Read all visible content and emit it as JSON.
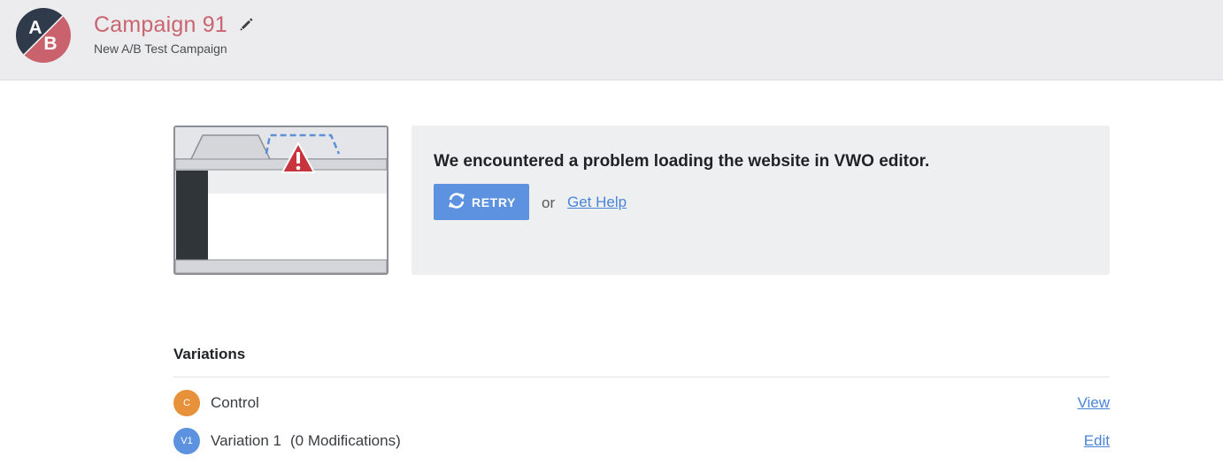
{
  "header": {
    "avatar": {
      "letters": [
        "A",
        "B"
      ],
      "colors": [
        "#2f3b4a",
        "#c9626c"
      ]
    },
    "title": "Campaign 91",
    "subtitle": "New A/B Test Campaign",
    "edit_icon": "pencil-icon"
  },
  "error": {
    "message": "We encountered a problem loading the website in VWO editor.",
    "retry_label": "RETRY",
    "retry_icon": "refresh-icon",
    "or_text": "or",
    "help_link": "Get Help",
    "illustration_icon": "warning-icon"
  },
  "variations": {
    "heading": "Variations",
    "items": [
      {
        "badge": "C",
        "badge_color": "#e8913b",
        "name": "Control",
        "modifications": "",
        "action": "View"
      },
      {
        "badge": "V1",
        "badge_color": "#5c92e0",
        "name": "Variation 1",
        "modifications": "(0 Modifications)",
        "action": "Edit"
      }
    ]
  },
  "colors": {
    "accent": "#5c92e0",
    "title": "#c96570",
    "link": "#4a84d6"
  }
}
